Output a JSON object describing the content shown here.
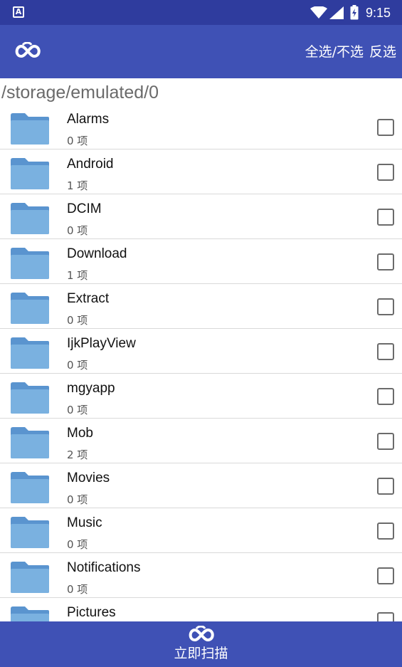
{
  "status_bar": {
    "app_badge": "A",
    "time": "9:15",
    "icons": [
      "app-notification-icon",
      "wifi-icon",
      "signal-icon",
      "battery-icon"
    ]
  },
  "app_bar": {
    "logo": "cloud-infinity-logo-icon",
    "select_all_label": "全选/不选",
    "invert_label": "反选"
  },
  "path": "/storage/emulated/0",
  "files": [
    {
      "name": "Alarms",
      "count": "0 项"
    },
    {
      "name": "Android",
      "count": "1 项"
    },
    {
      "name": "DCIM",
      "count": "0 项"
    },
    {
      "name": "Download",
      "count": "1 项"
    },
    {
      "name": "Extract",
      "count": "0 项"
    },
    {
      "name": "IjkPlayView",
      "count": "0 项"
    },
    {
      "name": "mgyapp",
      "count": "0 项"
    },
    {
      "name": "Mob",
      "count": "2 项"
    },
    {
      "name": "Movies",
      "count": "0 项"
    },
    {
      "name": "Music",
      "count": "0 项"
    },
    {
      "name": "Notifications",
      "count": "0 项"
    },
    {
      "name": "Pictures",
      "count": ""
    }
  ],
  "bottom_bar": {
    "label": "立即扫描"
  },
  "colors": {
    "status_bar": "#2f3c9e",
    "primary": "#3f51b5",
    "folder": "#7ab1e0",
    "folder_tab": "#5a94cf"
  }
}
